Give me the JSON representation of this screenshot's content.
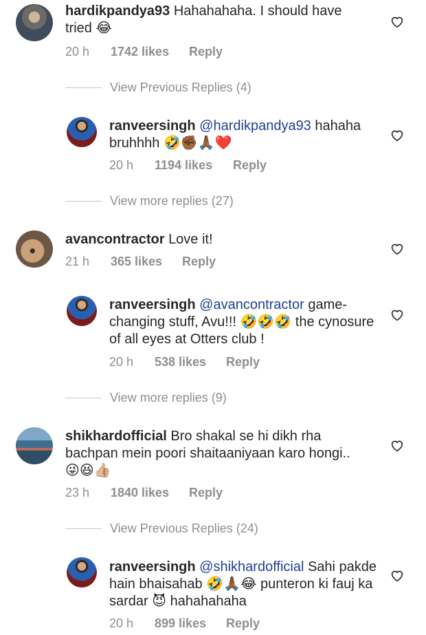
{
  "comments": [
    {
      "user": "hardikpandya93",
      "text": "Hahahahaha. I should have tried 😂",
      "time": "20 h",
      "likes": "1742 likes",
      "reply": "Reply",
      "more": "View Previous Replies (4)",
      "reply_item": {
        "user": "ranveersingh",
        "mention": "@hardikpandya93",
        "text": " hahaha bruhhhh 🤣✊🏾🙏🏾❤️",
        "time": "20 h",
        "likes": "1194 likes",
        "reply": "Reply",
        "more": "View more replies (27)"
      }
    },
    {
      "user": "avancontractor",
      "text": "Love it!",
      "time": "21 h",
      "likes": "365 likes",
      "reply": "Reply",
      "reply_item": {
        "user": "ranveersingh",
        "mention": "@avancontractor",
        "text": " game-changing stuff,  Avu!!! 🤣🤣🤣 the cynosure of all eyes at Otters club !",
        "time": "20 h",
        "likes": "538 likes",
        "reply": "Reply",
        "more": "View more replies (9)"
      }
    },
    {
      "user": "shikhardofficial",
      "text": "Bro shakal se hi dikh rha bachpan mein poori shaitaaniyaan karo hongi.. 😜😆👍🏼",
      "time": "23 h",
      "likes": "1840 likes",
      "reply": "Reply",
      "more": "View Previous Replies (24)",
      "reply_item": {
        "user": "ranveersingh",
        "mention": "@shikhardofficial",
        "text": " Sahi pakde hain bhaisahab 🤣🙏🏾😂 punteron ki fauj ka sardar 😈 hahahahaha",
        "time": "20 h",
        "likes": "899 likes",
        "reply": "Reply"
      }
    }
  ]
}
